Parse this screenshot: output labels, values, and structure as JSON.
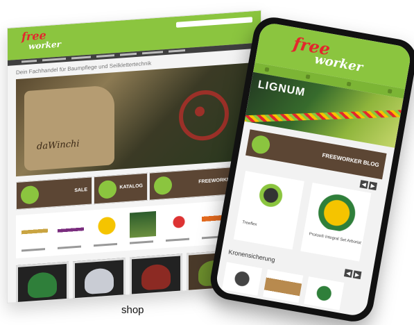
{
  "desktop": {
    "logo_top": "free",
    "logo_bottom": "worker",
    "tagline": "Dein Fachhandel für Baumpflege und Seilklettertechnik",
    "hero_brand": "daWinchi",
    "tiles": [
      {
        "label": "SALE"
      },
      {
        "label": "KATALOG"
      },
      {
        "label": "FREEWORKER BLOG"
      }
    ]
  },
  "phone": {
    "logo_top": "free",
    "logo_bottom": "worker",
    "banner_title": "LIGNUM",
    "blog_label": "FREEWORKER BLOG",
    "arrow_prev": "◀",
    "arrow_next": "▶",
    "products": [
      {
        "name": "Treeflex"
      },
      {
        "name": "Protos® Integral Set Arborist"
      }
    ],
    "section_title": "Kronensicherung"
  },
  "caption": "shop"
}
